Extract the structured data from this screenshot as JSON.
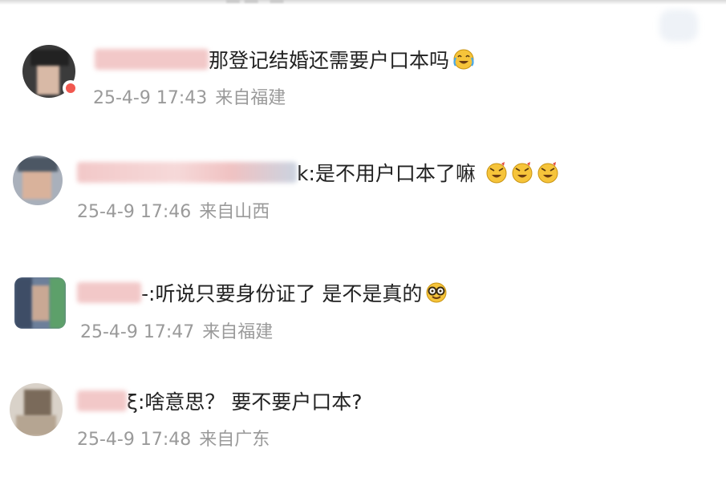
{
  "comments": [
    {
      "text": "那登记结婚还需要户口本吗",
      "emoji": "laughing-tears-emoji",
      "time": "25-4-9 17:43",
      "location": "来自福建"
    },
    {
      "text": "k:是不用户口本了嘛",
      "emoji": "cheeky-grin-emoji",
      "time": "25-4-9 17:46",
      "location": "来自山西"
    },
    {
      "text": "-:听说只要身份证了 是不是真的",
      "emoji": "nerd-glasses-emoji",
      "time": "25-4-9 17:47",
      "location": "来自福建"
    },
    {
      "text": "ξ:啥意思？ 要不要户口本?",
      "time": "25-4-9 17:48",
      "location": "来自广东"
    }
  ],
  "colors": {
    "text": "#222222",
    "meta": "#9a9a9a",
    "badge": "#f1584f",
    "emoji": "#f6c43a"
  }
}
